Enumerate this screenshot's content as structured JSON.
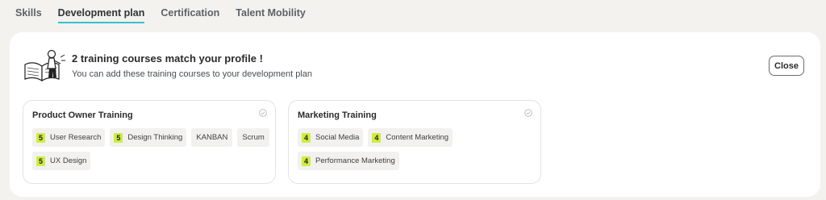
{
  "tabs": [
    {
      "label": "Skills",
      "active": false
    },
    {
      "label": "Development plan",
      "active": true
    },
    {
      "label": "Certification",
      "active": false
    },
    {
      "label": "Talent Mobility",
      "active": false
    }
  ],
  "panel": {
    "headline": "2 training courses match your profile !",
    "subline": "You can add these training courses to your development plan",
    "close_label": "Close",
    "illustration_icon": "person-reading-book-illustration"
  },
  "courses": [
    {
      "title": "Product Owner Training",
      "check_icon": "check-circle-icon",
      "skills": [
        {
          "level": "5",
          "name": "User Research"
        },
        {
          "level": "5",
          "name": "Design Thinking"
        },
        {
          "level": "",
          "name": "KANBAN"
        },
        {
          "level": "",
          "name": "Scrum"
        },
        {
          "level": "5",
          "name": "UX Design"
        }
      ]
    },
    {
      "title": "Marketing Training",
      "check_icon": "check-circle-icon",
      "skills": [
        {
          "level": "4",
          "name": "Social Media"
        },
        {
          "level": "4",
          "name": "Content Marketing"
        },
        {
          "level": "4",
          "name": "Performance Marketing"
        }
      ]
    }
  ],
  "colors": {
    "active_tab_underline": "#34c3cc",
    "level_badge": "#cdee3d",
    "background": "#f3f2ef"
  }
}
